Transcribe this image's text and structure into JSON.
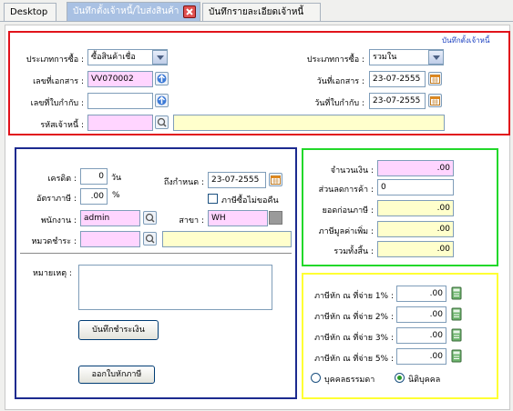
{
  "tabs": [
    {
      "label": "Desktop"
    },
    {
      "label": "บันทึกตั้งเจ้าหนี้/ใบส่งสินค้า"
    },
    {
      "label": "บันทึกรายละเอียดเจ้าหนี้"
    }
  ],
  "header": {
    "section_title": "บันทึกตั้งเจ้าหนี้",
    "purchase_type_label": "ประเภทการซื้อ :",
    "purchase_type_value": "ซื้อสินค้าเชื่อ",
    "doc_no_label": "เลขที่เอกสาร :",
    "doc_no_value": "VV070002",
    "receipt_no_label": "เลขที่ใบกำกับ :",
    "receipt_no_value": "",
    "creditor_code_label": "รหัสเจ้าหนี้ :",
    "creditor_code_value": "",
    "creditor_name_value": "",
    "vat_type_label": "ประเภทการซื้อ :",
    "vat_type_value": "รวมใน",
    "doc_date_label": "วันที่เอกสาร :",
    "doc_date_value": "23-07-2555",
    "receipt_date_label": "วันที่ใบกำกับ :",
    "receipt_date_value": "23-07-2555"
  },
  "terms": {
    "credit_label": "เครดิต :",
    "credit_value": "0",
    "credit_unit": "วัน",
    "due_label": "ถึงกำหนด :",
    "due_value": "23-07-2555",
    "tax_rate_label": "อัตราภาษี :",
    "tax_rate_value": ".00",
    "tax_rate_unit": "%",
    "no_refund_label": "ภาษีซื้อไม่ขอคืน",
    "employee_label": "พนักงาน :",
    "employee_value": "admin",
    "branch_label": "สาขา :",
    "branch_value": "WH",
    "payment_label": "หมวดชำระ :",
    "payment_value": "",
    "payment_name_value": "",
    "note_label": "หมายเหตุ :",
    "note_value": "",
    "record_payment_button": "บันทึกชำระเงิน",
    "withholding_button": "ออกใบหักภาษี"
  },
  "totals": {
    "amount_label": "จำนวนเงิน :",
    "amount_value": ".00",
    "discount_label": "ส่วนลดการค้า :",
    "discount_value": "0",
    "before_tax_label": "ยอดก่อนภาษี :",
    "before_tax_value": ".00",
    "vat_label": "ภาษีมูลค่าเพิ่ม :",
    "vat_value": ".00",
    "grand_total_label": "รวมทั้งสิ้น :",
    "grand_total_value": ".00"
  },
  "withholding": {
    "wht1_label": "ภาษีหัก ณ ที่จ่าย 1% :",
    "wht1_value": ".00",
    "wht2_label": "ภาษีหัก ณ ที่จ่าย 2% :",
    "wht2_value": ".00",
    "wht3_label": "ภาษีหัก ณ ที่จ่าย 3% :",
    "wht3_value": ".00",
    "wht5_label": "ภาษีหัก ณ ที่จ่าย 5% :",
    "wht5_value": ".00",
    "person_label": "บุคคลธรรมดา",
    "company_label": "นิติบุคคล"
  },
  "colors": {
    "red_panel": "#e1131b",
    "blue_panel": "#1c2a8f",
    "green_panel": "#22d82a",
    "yellow_panel": "#ffff33"
  }
}
